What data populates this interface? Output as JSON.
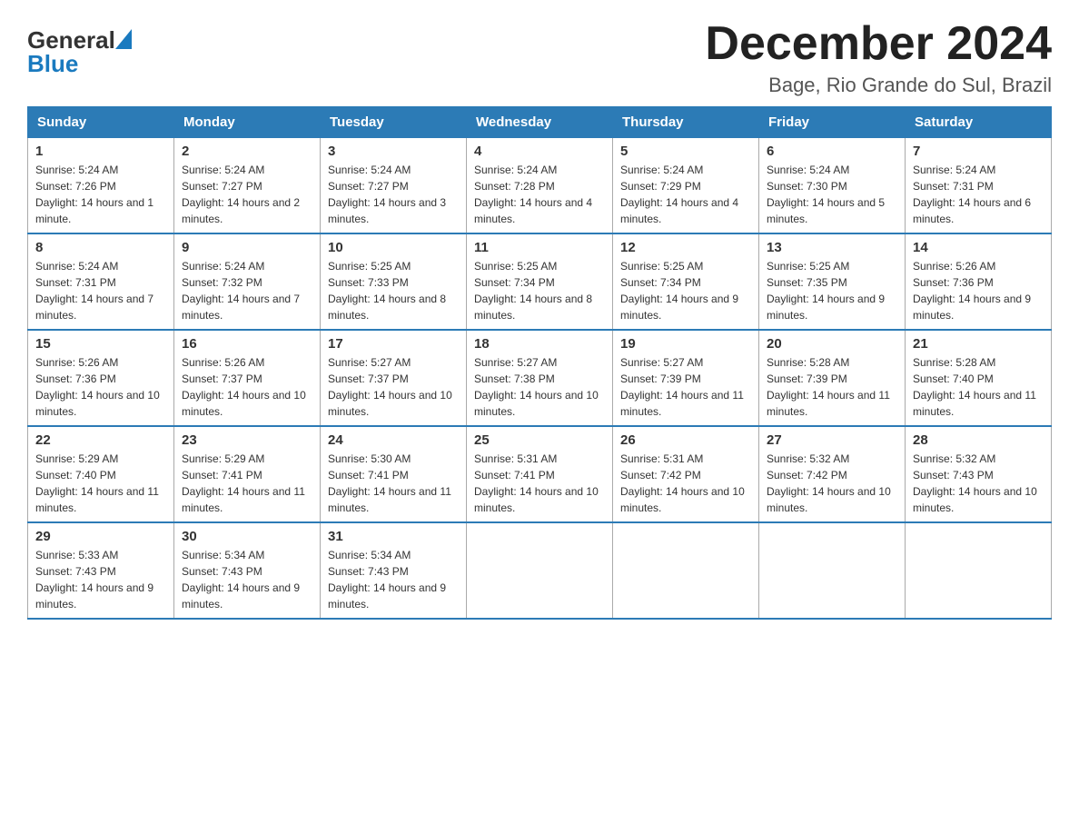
{
  "header": {
    "logo_general": "General",
    "logo_blue": "Blue",
    "title": "December 2024",
    "subtitle": "Bage, Rio Grande do Sul, Brazil"
  },
  "days_of_week": [
    "Sunday",
    "Monday",
    "Tuesday",
    "Wednesday",
    "Thursday",
    "Friday",
    "Saturday"
  ],
  "weeks": [
    [
      {
        "day": "1",
        "sunrise": "Sunrise: 5:24 AM",
        "sunset": "Sunset: 7:26 PM",
        "daylight": "Daylight: 14 hours and 1 minute."
      },
      {
        "day": "2",
        "sunrise": "Sunrise: 5:24 AM",
        "sunset": "Sunset: 7:27 PM",
        "daylight": "Daylight: 14 hours and 2 minutes."
      },
      {
        "day": "3",
        "sunrise": "Sunrise: 5:24 AM",
        "sunset": "Sunset: 7:27 PM",
        "daylight": "Daylight: 14 hours and 3 minutes."
      },
      {
        "day": "4",
        "sunrise": "Sunrise: 5:24 AM",
        "sunset": "Sunset: 7:28 PM",
        "daylight": "Daylight: 14 hours and 4 minutes."
      },
      {
        "day": "5",
        "sunrise": "Sunrise: 5:24 AM",
        "sunset": "Sunset: 7:29 PM",
        "daylight": "Daylight: 14 hours and 4 minutes."
      },
      {
        "day": "6",
        "sunrise": "Sunrise: 5:24 AM",
        "sunset": "Sunset: 7:30 PM",
        "daylight": "Daylight: 14 hours and 5 minutes."
      },
      {
        "day": "7",
        "sunrise": "Sunrise: 5:24 AM",
        "sunset": "Sunset: 7:31 PM",
        "daylight": "Daylight: 14 hours and 6 minutes."
      }
    ],
    [
      {
        "day": "8",
        "sunrise": "Sunrise: 5:24 AM",
        "sunset": "Sunset: 7:31 PM",
        "daylight": "Daylight: 14 hours and 7 minutes."
      },
      {
        "day": "9",
        "sunrise": "Sunrise: 5:24 AM",
        "sunset": "Sunset: 7:32 PM",
        "daylight": "Daylight: 14 hours and 7 minutes."
      },
      {
        "day": "10",
        "sunrise": "Sunrise: 5:25 AM",
        "sunset": "Sunset: 7:33 PM",
        "daylight": "Daylight: 14 hours and 8 minutes."
      },
      {
        "day": "11",
        "sunrise": "Sunrise: 5:25 AM",
        "sunset": "Sunset: 7:34 PM",
        "daylight": "Daylight: 14 hours and 8 minutes."
      },
      {
        "day": "12",
        "sunrise": "Sunrise: 5:25 AM",
        "sunset": "Sunset: 7:34 PM",
        "daylight": "Daylight: 14 hours and 9 minutes."
      },
      {
        "day": "13",
        "sunrise": "Sunrise: 5:25 AM",
        "sunset": "Sunset: 7:35 PM",
        "daylight": "Daylight: 14 hours and 9 minutes."
      },
      {
        "day": "14",
        "sunrise": "Sunrise: 5:26 AM",
        "sunset": "Sunset: 7:36 PM",
        "daylight": "Daylight: 14 hours and 9 minutes."
      }
    ],
    [
      {
        "day": "15",
        "sunrise": "Sunrise: 5:26 AM",
        "sunset": "Sunset: 7:36 PM",
        "daylight": "Daylight: 14 hours and 10 minutes."
      },
      {
        "day": "16",
        "sunrise": "Sunrise: 5:26 AM",
        "sunset": "Sunset: 7:37 PM",
        "daylight": "Daylight: 14 hours and 10 minutes."
      },
      {
        "day": "17",
        "sunrise": "Sunrise: 5:27 AM",
        "sunset": "Sunset: 7:37 PM",
        "daylight": "Daylight: 14 hours and 10 minutes."
      },
      {
        "day": "18",
        "sunrise": "Sunrise: 5:27 AM",
        "sunset": "Sunset: 7:38 PM",
        "daylight": "Daylight: 14 hours and 10 minutes."
      },
      {
        "day": "19",
        "sunrise": "Sunrise: 5:27 AM",
        "sunset": "Sunset: 7:39 PM",
        "daylight": "Daylight: 14 hours and 11 minutes."
      },
      {
        "day": "20",
        "sunrise": "Sunrise: 5:28 AM",
        "sunset": "Sunset: 7:39 PM",
        "daylight": "Daylight: 14 hours and 11 minutes."
      },
      {
        "day": "21",
        "sunrise": "Sunrise: 5:28 AM",
        "sunset": "Sunset: 7:40 PM",
        "daylight": "Daylight: 14 hours and 11 minutes."
      }
    ],
    [
      {
        "day": "22",
        "sunrise": "Sunrise: 5:29 AM",
        "sunset": "Sunset: 7:40 PM",
        "daylight": "Daylight: 14 hours and 11 minutes."
      },
      {
        "day": "23",
        "sunrise": "Sunrise: 5:29 AM",
        "sunset": "Sunset: 7:41 PM",
        "daylight": "Daylight: 14 hours and 11 minutes."
      },
      {
        "day": "24",
        "sunrise": "Sunrise: 5:30 AM",
        "sunset": "Sunset: 7:41 PM",
        "daylight": "Daylight: 14 hours and 11 minutes."
      },
      {
        "day": "25",
        "sunrise": "Sunrise: 5:31 AM",
        "sunset": "Sunset: 7:41 PM",
        "daylight": "Daylight: 14 hours and 10 minutes."
      },
      {
        "day": "26",
        "sunrise": "Sunrise: 5:31 AM",
        "sunset": "Sunset: 7:42 PM",
        "daylight": "Daylight: 14 hours and 10 minutes."
      },
      {
        "day": "27",
        "sunrise": "Sunrise: 5:32 AM",
        "sunset": "Sunset: 7:42 PM",
        "daylight": "Daylight: 14 hours and 10 minutes."
      },
      {
        "day": "28",
        "sunrise": "Sunrise: 5:32 AM",
        "sunset": "Sunset: 7:43 PM",
        "daylight": "Daylight: 14 hours and 10 minutes."
      }
    ],
    [
      {
        "day": "29",
        "sunrise": "Sunrise: 5:33 AM",
        "sunset": "Sunset: 7:43 PM",
        "daylight": "Daylight: 14 hours and 9 minutes."
      },
      {
        "day": "30",
        "sunrise": "Sunrise: 5:34 AM",
        "sunset": "Sunset: 7:43 PM",
        "daylight": "Daylight: 14 hours and 9 minutes."
      },
      {
        "day": "31",
        "sunrise": "Sunrise: 5:34 AM",
        "sunset": "Sunset: 7:43 PM",
        "daylight": "Daylight: 14 hours and 9 minutes."
      },
      null,
      null,
      null,
      null
    ]
  ]
}
